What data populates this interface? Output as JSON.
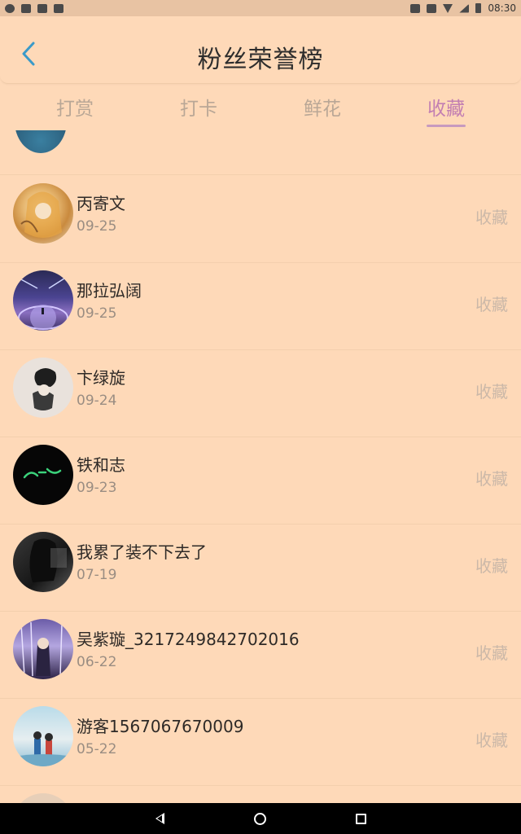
{
  "status_bar": {
    "time": "08:30",
    "icons": [
      "notification-icon",
      "photo-icon",
      "app-icon",
      "image-icon",
      "cast-icon",
      "vibrate-icon",
      "wifi-icon",
      "signal-icon",
      "battery-icon"
    ]
  },
  "header": {
    "back_icon": "chevron-left-icon",
    "title": "粉丝荣誉榜"
  },
  "tabs": [
    {
      "label": "打赏",
      "active": false
    },
    {
      "label": "打卡",
      "active": false
    },
    {
      "label": "鲜花",
      "active": false
    },
    {
      "label": "收藏",
      "active": true
    }
  ],
  "list": {
    "items": [
      {
        "name": "丙寄文",
        "date": "09-25",
        "action": "收藏",
        "avatar": "anime-blonde-girl-avatar"
      },
      {
        "name": "那拉弘阔",
        "date": "09-25",
        "action": "收藏",
        "avatar": "night-sky-avatar"
      },
      {
        "name": "卞绿旋",
        "date": "09-24",
        "action": "收藏",
        "avatar": "girl-hat-avatar"
      },
      {
        "name": "铁和志",
        "date": "09-23",
        "action": "收藏",
        "avatar": "neon-text-avatar"
      },
      {
        "name": "我累了装不下去了",
        "date": "07-19",
        "action": "收藏",
        "avatar": "dark-portrait-avatar"
      },
      {
        "name": "吴紫璇_3217249842702016",
        "date": "06-22",
        "action": "收藏",
        "avatar": "anime-purple-avatar"
      },
      {
        "name": "游客1567067670009",
        "date": "05-22",
        "action": "收藏",
        "avatar": "cartoon-couple-avatar"
      }
    ]
  },
  "colors": {
    "background": "#fed9b8",
    "active_tab": "#c37fb2",
    "inactive_tab": "#b9a796",
    "action_text": "#cbb8a8",
    "back_icon": "#3a9ac9"
  }
}
